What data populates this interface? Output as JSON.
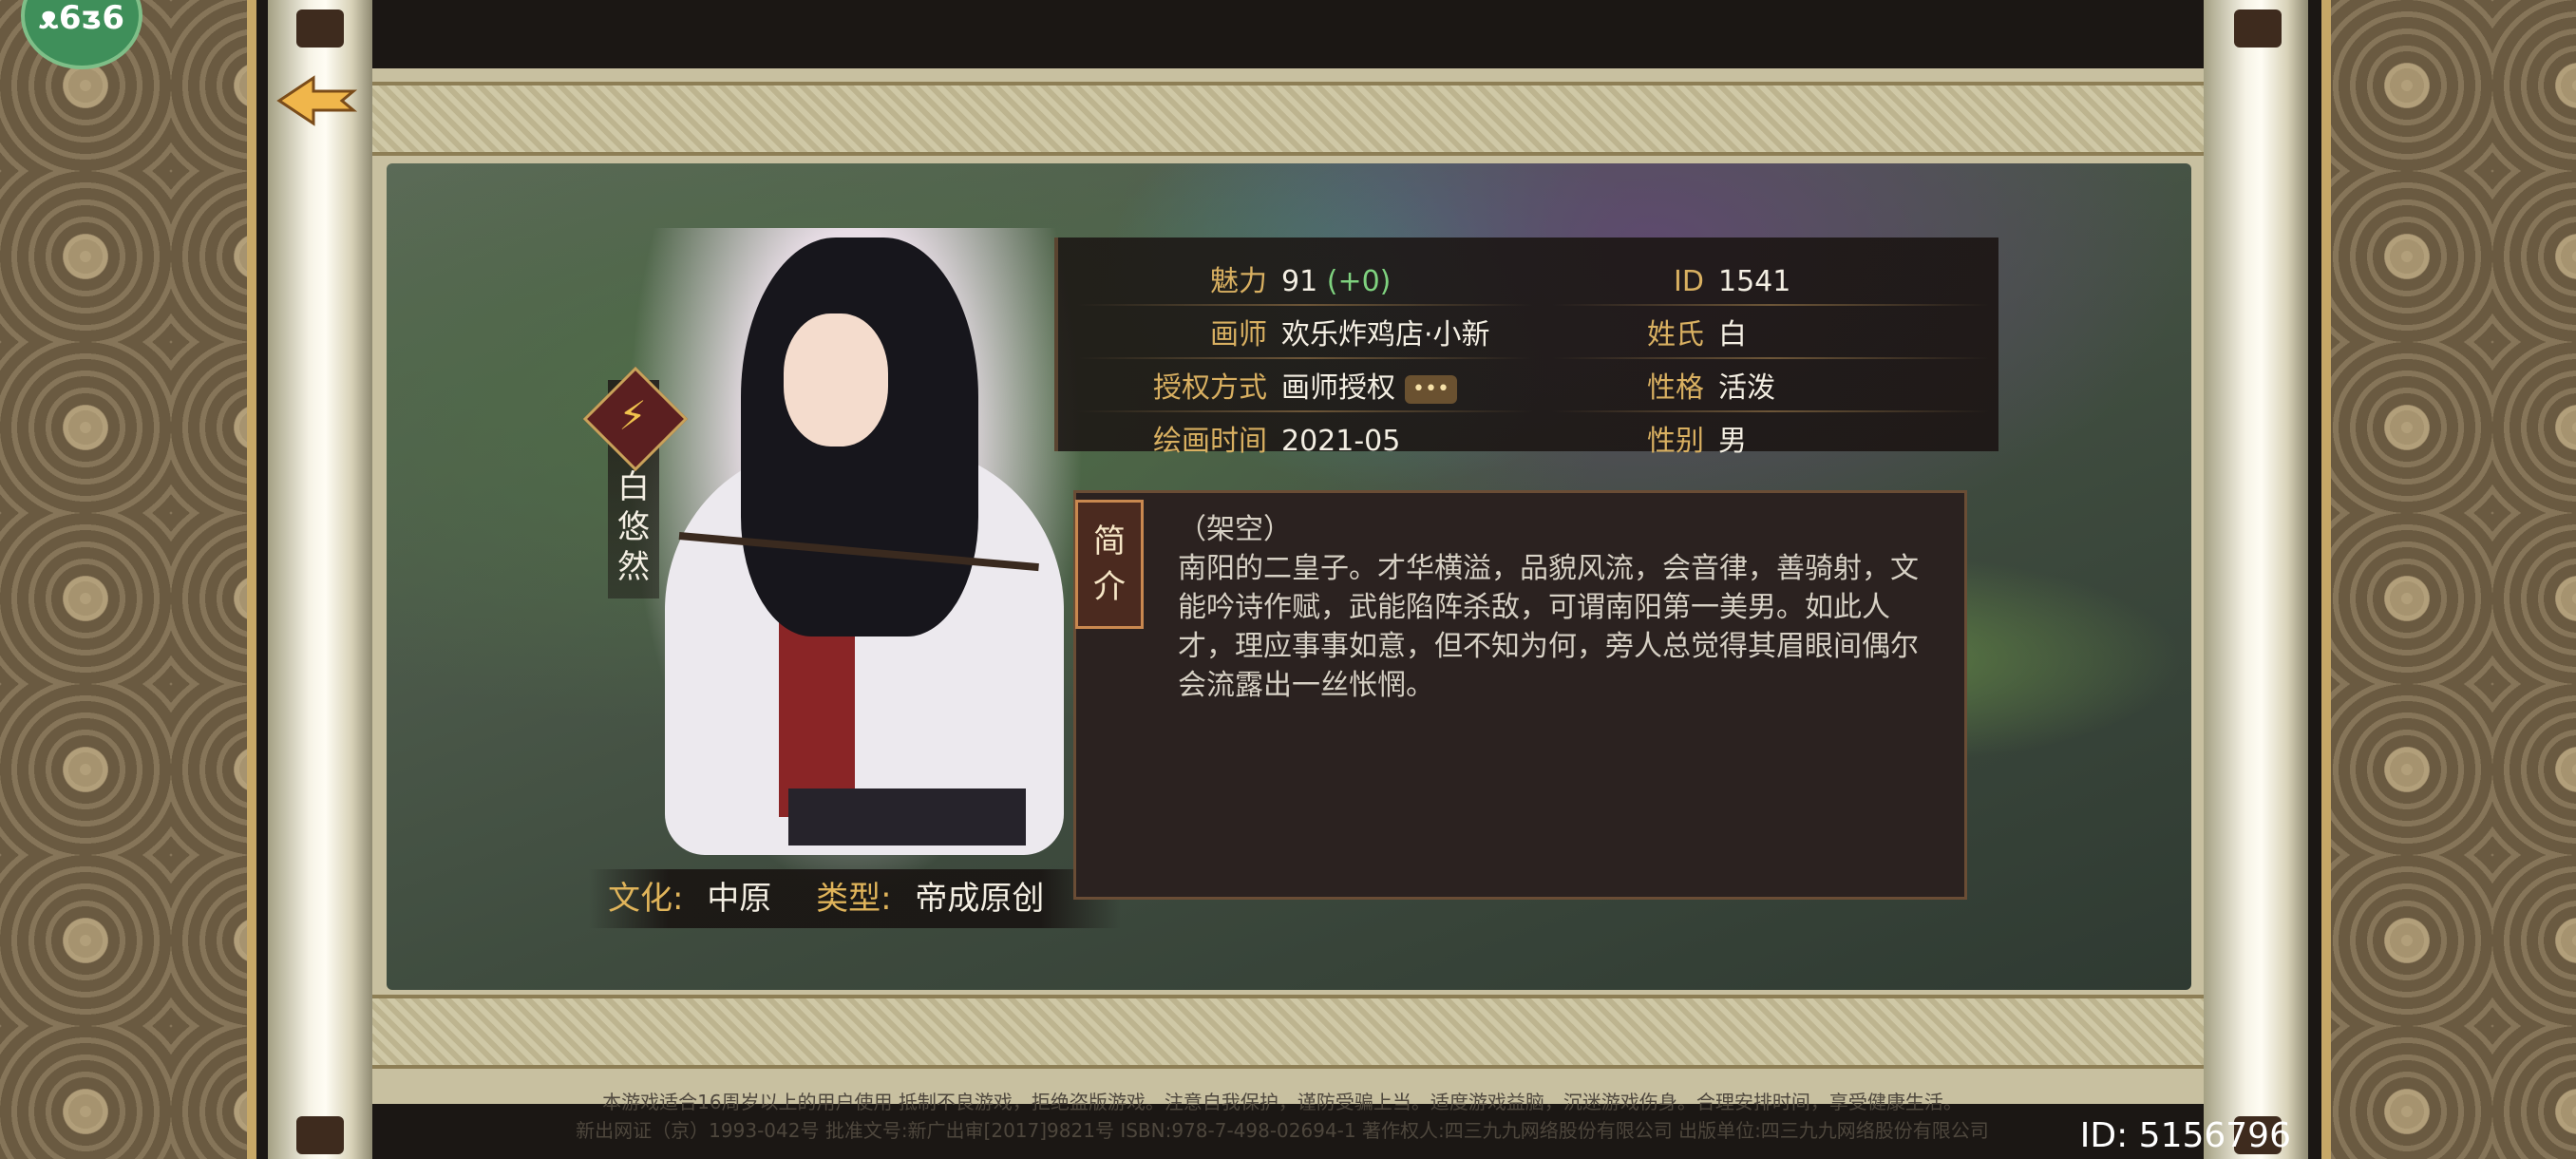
{
  "badge": {
    "text": "ᴥ6ᴣ6"
  },
  "back_button": {
    "icon": "arrow-left-icon"
  },
  "character": {
    "name_chars": [
      "白",
      "悠",
      "然"
    ],
    "attribute_icon": "lightning-icon",
    "culture_label": "文化:",
    "culture_value": "中原",
    "type_label": "类型:",
    "type_value": "帝成原创"
  },
  "info": {
    "charm_label": "魅力",
    "charm_value": "91",
    "charm_bonus": "(+0)",
    "id_label": "ID",
    "id_value": "1541",
    "artist_label": "画师",
    "artist_value": "欢乐炸鸡店·小新",
    "surname_label": "姓氏",
    "surname_value": "白",
    "license_label": "授权方式",
    "license_value": "画师授权",
    "license_more": "•••",
    "personality_label": "性格",
    "personality_value": "活泼",
    "date_label": "绘画时间",
    "date_value": "2021-05",
    "gender_label": "性别",
    "gender_value": "男"
  },
  "description": {
    "tab_chars": [
      "简",
      "介"
    ],
    "prefix": "（架空）",
    "text": "南阳的二皇子。才华横溢，品貌风流，会音律，善骑射，文能吟诗作赋，武能陷阵杀敌，可谓南阳第一美男。如此人才，理应事事如意，但不知为何，旁人总觉得其眉眼间偶尔会流露出一丝怅惘。"
  },
  "footer": {
    "line1": "本游戏适合16周岁以上的用户使用    抵制不良游戏，拒绝盗版游戏。注意自我保护，谨防受骗上当。适度游戏益脑，沉迷游戏伤身。合理安排时间，享受健康生活。",
    "line2": "新出网证（京）1993-042号  批准文号:新广出审[2017]9821号  ISBN:978-7-498-02694-1  著作权人:四三九九网络股份有限公司  出版单位:四三九九网络股份有限公司"
  },
  "player_id": "ID: 5156796",
  "colors": {
    "label_gold": "#d9b061",
    "positive_green": "#7fd27f",
    "panel_bg": "#2b2220"
  }
}
